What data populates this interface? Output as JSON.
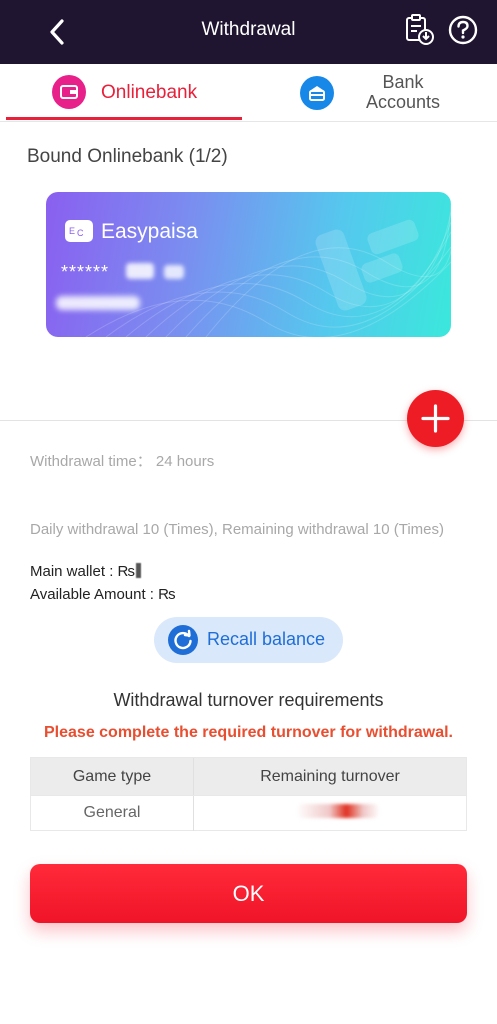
{
  "header": {
    "title": "Withdrawal",
    "back_icon": "chevron-left-icon",
    "record_icon": "clipboard-download-icon",
    "help_icon": "question-circle-icon"
  },
  "tabs": [
    {
      "label": "Onlinebank",
      "icon": "wallet-icon",
      "active": true
    },
    {
      "label": "Bank Accounts",
      "icon": "bank-card-icon",
      "active": false
    }
  ],
  "bound_section": {
    "title": "Bound Onlinebank (1/2)"
  },
  "card": {
    "name": "Easypaisa",
    "number_masked": "******",
    "logo_letters": "E C"
  },
  "info": {
    "withdrawal_time": "Withdrawal time：  24 hours",
    "daily": "Daily withdrawal 10 (Times), Remaining withdrawal 10 (Times)",
    "main_wallet": "Main wallet : ₨",
    "available_amount": "Available Amount : ₨"
  },
  "recall": {
    "label": "Recall balance",
    "icon": "refresh-icon"
  },
  "turnover": {
    "title": "Withdrawal turnover requirements",
    "warning": "Please complete the required turnover for withdrawal.",
    "columns": [
      "Game type",
      "Remaining turnover"
    ],
    "rows": [
      {
        "game_type": "General"
      }
    ]
  },
  "ok_button": {
    "label": "OK"
  },
  "colors": {
    "header_bg": "#1f1530",
    "accent_red": "#ee1c24",
    "tab_active": "#e8203a",
    "recall_blue": "#1f6ed8",
    "warning": "#e84e30"
  }
}
